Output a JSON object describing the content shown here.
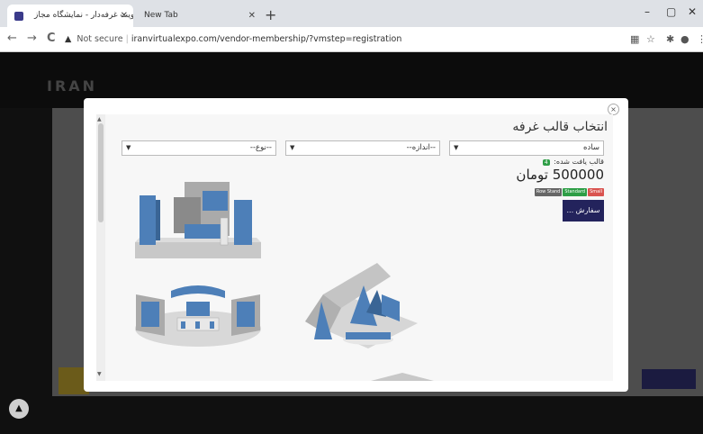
{
  "browser": {
    "tabs": [
      {
        "title": "عضویت غرفه‌دار - نمایشگاه مجاز",
        "active": true
      },
      {
        "title": "New Tab",
        "active": false
      }
    ],
    "new_tab_glyph": "+",
    "window_controls": [
      "–",
      "▢",
      "✕"
    ],
    "nav": {
      "back": "←",
      "forward": "→",
      "reload": "C"
    },
    "security_label": "Not secure",
    "url": "iranvirtualexpo.com/vendor-membership/?vmstep=registration"
  },
  "site": {
    "logo_text": "IRAN"
  },
  "modal": {
    "title": "انتخاب قالب غرفه",
    "close_glyph": "×",
    "filters": {
      "type": {
        "value": "ساده"
      },
      "size": {
        "value": "--اندازه--"
      },
      "kind": {
        "value": "--نوع--"
      }
    },
    "found_label": "قالب یافت شده:",
    "found_count": "4",
    "price": "500000 تومان",
    "badges": [
      {
        "label": "Row Stand",
        "color": "#666666"
      },
      {
        "label": "Standard",
        "color": "#2e9e46"
      },
      {
        "label": "Small",
        "color": "#d9534f"
      }
    ],
    "order_button": "سفارش ..."
  },
  "booths": [
    {
      "name": "booth-template-1"
    },
    {
      "name": "booth-template-2"
    },
    {
      "name": "booth-template-3"
    },
    {
      "name": "booth-template-4"
    }
  ],
  "icons": [
    "favicon",
    "close-icon",
    "warning-icon",
    "translate-icon",
    "star-icon",
    "extensions-icon",
    "profile-icon",
    "chevron-down-icon",
    "scroll-up-icon"
  ],
  "colors": {
    "accent": "#23235c",
    "booth_blue": "#4d7fb8",
    "booth_gray": "#c8c8c8"
  }
}
